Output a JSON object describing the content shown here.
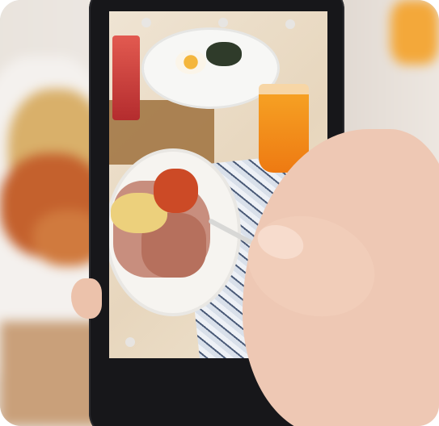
{
  "scene": {
    "subject": "hand-holding-smartphone-photographing-breakfast",
    "icons": [
      "camera-shutter-icon",
      "camera-switch-icon",
      "camera-mode-icon",
      "flash-icon"
    ],
    "colors": {
      "phone_body": "#17171a",
      "juice": "#ee7a12",
      "skin": "#eec8b4",
      "background_blur": "#e2dbd3"
    }
  }
}
